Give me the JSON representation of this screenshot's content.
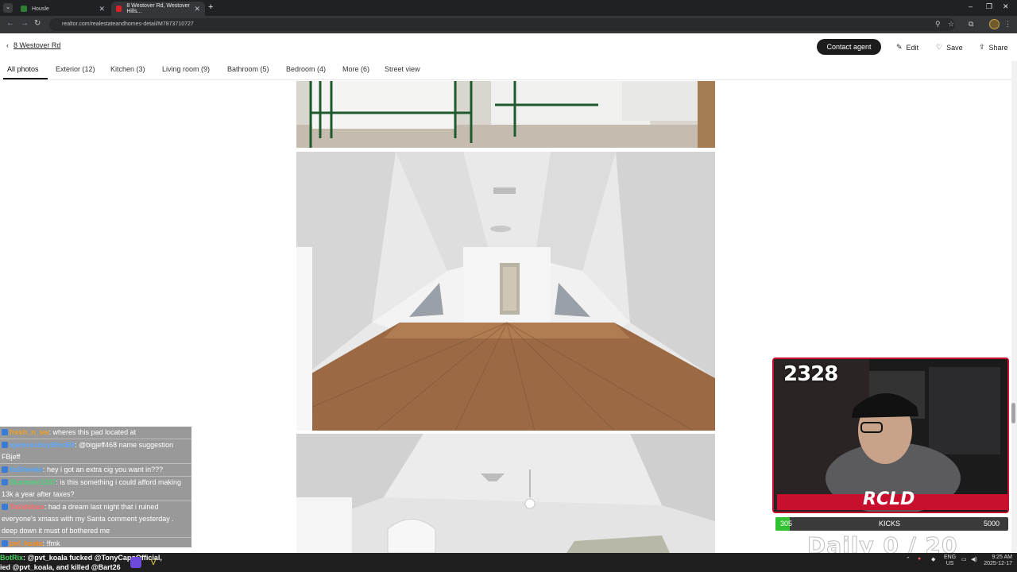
{
  "browser": {
    "tabs": [
      {
        "title": "Housle",
        "active": false,
        "favicon_color": "#2e7d32"
      },
      {
        "title": "8 Westover Rd, Westover Hills...",
        "active": true,
        "favicon_color": "#d92228"
      }
    ],
    "url": "realtor.com/realestateandhomes-detail/M7873710727"
  },
  "header": {
    "back_label": "8 Westover Rd",
    "contact_label": "Contact agent",
    "edit_label": "Edit",
    "save_label": "Save",
    "share_label": "Share"
  },
  "photo_tabs": [
    {
      "label": "All photos",
      "active": true
    },
    {
      "label": "Exterior (12)",
      "active": false
    },
    {
      "label": "Kitchen (3)",
      "active": false
    },
    {
      "label": "Living room (9)",
      "active": false
    },
    {
      "label": "Bathroom (5)",
      "active": false
    },
    {
      "label": "Bedroom (4)",
      "active": false
    },
    {
      "label": "More (6)",
      "active": false
    },
    {
      "label": "Street view",
      "active": false
    }
  ],
  "chat": [
    {
      "user": "fresh_n_sw",
      "text": ": wheres this pad located at",
      "color": "#f0a020"
    },
    {
      "user": "xjamesxboy69xd69",
      "text": ": @bigjeff468 name suggestion FBjeff",
      "color": "#5fa8ff"
    },
    {
      "user": "ItsSheeks",
      "text": ": hey i got an extra cig you want in???",
      "color": "#4aa8ff"
    },
    {
      "user": "Slummer1337",
      "text": ": is this something i could afford making 13k a year after taxes?",
      "color": "#4bd17a"
    },
    {
      "user": "Taxidebux",
      "text": ": had a dream last night that i ruined everyone's xmass with my Santa comment yesterday . deep down it must of bothered me",
      "color": "#ff6b6b"
    },
    {
      "user": "pvt_koala",
      "text": ": !fmk",
      "color": "#ff8c1a"
    }
  ],
  "ticker": {
    "line1_user": "BotRix",
    "line1_text": ": @pvt_koala fucked @TonyCapoOfficial,",
    "line2_text": "ied @pvt_koala, and killed @Bart26"
  },
  "stream": {
    "viewer_count": "2328",
    "logo_text": "RCLD",
    "kicks_current": "305",
    "kicks_label": "KICKS",
    "kicks_goal": "5000",
    "kicks_progress": 0.061,
    "daily_text": "Daily 0 / 20"
  },
  "tray": {
    "lang": "ENG",
    "region": "US",
    "time": "9:25 AM",
    "date": "2025-12-17"
  }
}
